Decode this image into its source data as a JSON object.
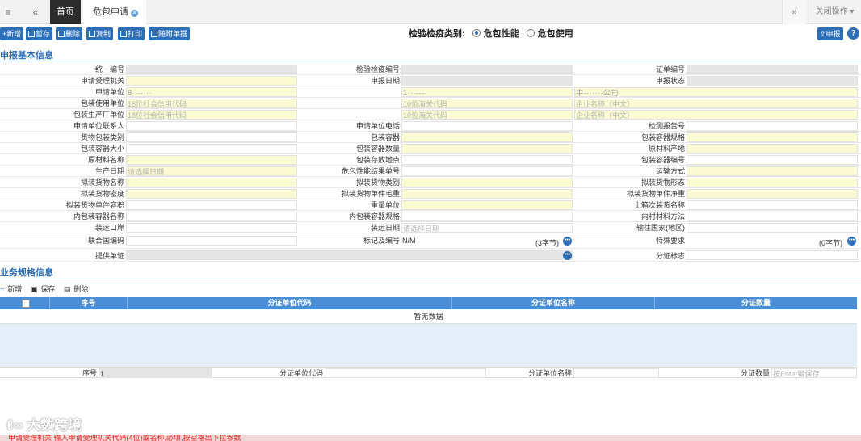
{
  "topbar": {
    "menu_icon": "hamburger-icon",
    "back_icon": "double-left-icon",
    "home_tab": "首页",
    "active_tab": "危包申请",
    "forward_icon": "double-right-icon",
    "close_ops": "关闭操作",
    "close_ops_arrow": "▾"
  },
  "toolbar": {
    "buttons": [
      "新增",
      "暂存",
      "删除",
      "复制",
      "打印",
      "随附单据"
    ],
    "category_label": "检验检疫类别:",
    "options": [
      "危包性能",
      "危包使用"
    ],
    "selected_option": "危包性能",
    "report": "申报",
    "help": "?"
  },
  "section1_title": "申报基本信息",
  "form": {
    "row1": [
      "统一编号",
      "检验检疫编号",
      "证单编号"
    ],
    "row2": [
      "申请受理机关",
      "申报日期",
      "申报状态"
    ],
    "row3": {
      "labels": [
        "申请单位"
      ],
      "v1": "8·······",
      "v2": "1·······",
      "v3": "中·······公司"
    },
    "row4": {
      "labels": [
        "包装使用单位"
      ],
      "p1": "18位社会信用代码",
      "p2": "10位海关代码",
      "p3": "企业名称（中文）"
    },
    "row5": {
      "labels": [
        "包装生产厂单位"
      ],
      "p1": "18位社会信用代码",
      "p2": "10位海关代码",
      "p3": "企业名称（中文）"
    },
    "row6": [
      "申请单位联系人",
      "申请单位电话",
      "检测报告号"
    ],
    "row7": [
      "货物包装类别",
      "包装容器",
      "包装容器规格"
    ],
    "row8": [
      "包装容器大小",
      "包装容器数量",
      "原材料产地"
    ],
    "row9": [
      "原材料名称",
      "包装存放地点",
      "包装容器编号"
    ],
    "row10": [
      "生产日期",
      "危包性能结果单号",
      "运输方式"
    ],
    "row10_ph": "请选择日期",
    "row11": [
      "拟装货物名称",
      "拟装货物类别",
      "拟装货物形态"
    ],
    "row12": [
      "拟装货物密度",
      "拟装货物单件毛重",
      "拟装货物单件净重"
    ],
    "row13": [
      "拟装货物单件容积",
      "重量单位",
      "上箱次装货名称"
    ],
    "row14": [
      "内包装容器名称",
      "内包装容器规格",
      "内衬材料方法"
    ],
    "row15": [
      "装运口岸",
      "装运日期",
      "输往国家(地区)"
    ],
    "row15_ph": "请选择日期",
    "row16": [
      "联合国编码",
      "标记及编号",
      "特殊要求"
    ],
    "mark_value": "N/M",
    "mark_count": "(3字节)",
    "special_count": "(0字节)",
    "row17": [
      "提供单证",
      "分证标志"
    ]
  },
  "section2_title": "业务规格信息",
  "bt_tools": [
    "新增",
    "保存",
    "删除"
  ],
  "table": {
    "headers": [
      "序号",
      "分证单位代码",
      "分证单位名称",
      "分证数量"
    ],
    "empty": "暂无数据"
  },
  "detail": {
    "labels": [
      "序号",
      "分证单位代码",
      "分证单位名称",
      "分证数量"
    ],
    "seq_value": "1",
    "qty_placeholder": "按Enter键保存"
  },
  "watermark": "大数跨境",
  "status_text": "申请受理机关 输入申请受理机关代码(4位)或名称,必填,按空格出下拉参数"
}
